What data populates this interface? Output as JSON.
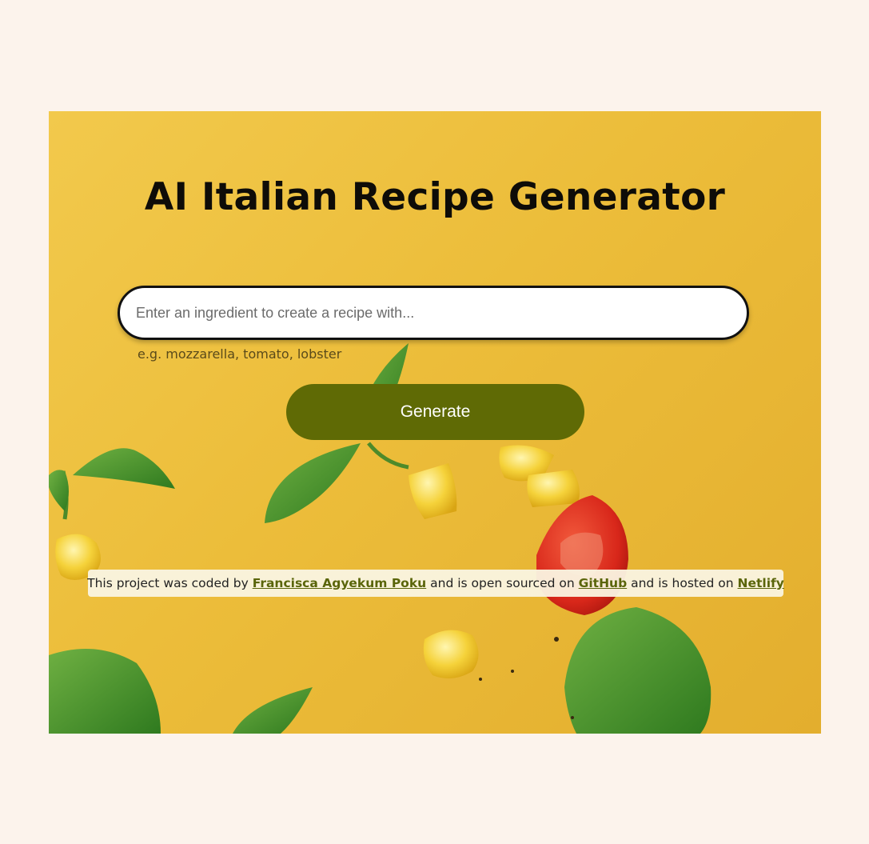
{
  "page": {
    "background_color": "#fcf3ec",
    "card_color": "#ecbd3a"
  },
  "header": {
    "title": "AI Italian Recipe Generator"
  },
  "form": {
    "input_placeholder": "Enter an ingredient to create a recipe with...",
    "input_value": "",
    "hint": "e.g. mozzarella, tomato, lobster",
    "generate_label": "Generate",
    "button_color": "#5f6a05"
  },
  "footer": {
    "text_1": "This project was coded by",
    "author_link": "Francisca Agyekum Poku",
    "text_2": "and is open sourced on",
    "github_link": "GitHub",
    "text_3": "and is hosted on",
    "netlify_link": "Netlify",
    "link_color": "#5a650a"
  },
  "background_art": {
    "icons": [
      "basil-leaf-icon",
      "corn-kernel-icon",
      "cherry-tomato-icon"
    ]
  }
}
